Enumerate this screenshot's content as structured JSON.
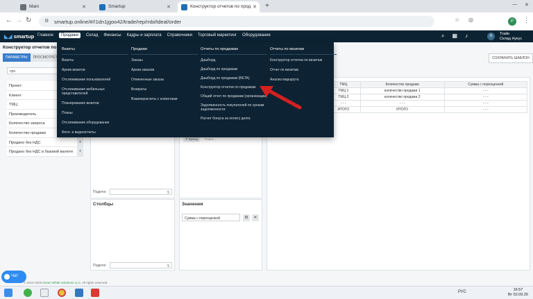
{
  "browser": {
    "tabs": [
      {
        "label": "Main",
        "color": "#6a6f77"
      },
      {
        "label": "Smartup",
        "color": "#1e6fb5"
      },
      {
        "label": "Конструктор отчетов по прод",
        "color": "#1e6fb5"
      }
    ],
    "url": "smartup.online/#/!1dn1jgoo42/trade/rep/mbi/tdeal/order"
  },
  "header": {
    "logo": "smartup",
    "menu": [
      "Главное",
      "Продажи",
      "Склад",
      "Финансы",
      "Кадры и зарплата",
      "Справочники",
      "Торговый маркетинг",
      "Оборудование"
    ],
    "active_menu": "Продажи",
    "avatar_letter": "A",
    "user_line1": "Trade",
    "user_line2": "Склад Нукус"
  },
  "page": {
    "title": "Конструктор отчетов по п",
    "tabs": [
      "ПАРАМЕТРЫ",
      "ПРОСМОТРЕТЬ"
    ],
    "save_template": "СОХРАНИТЬ ШАБЛОН",
    "filter_value": "про",
    "fields": [
      "Проект",
      "Клиент",
      "ТМЦ",
      "Производитель",
      "Количество запроса",
      "Количество продажи",
      "Продано без НДС",
      "Продано без НДС в базовой валюте"
    ],
    "columns_title": "Столбцы",
    "values_title": "Значения",
    "per_page_label": "Подитог",
    "per_page_value": "5",
    "chip_brand": "Бренд",
    "chip_search": "Поиск...",
    "value_field": "Сумма с переоценкой"
  },
  "table": {
    "headers": [
      "ТМЦ",
      "Количество продажи",
      "Сумма с переоценкой"
    ],
    "rows": [
      [
        "ТМЦ 1",
        "количество продажи 1",
        "- - -"
      ],
      [
        "ТМЦ 2",
        "количество продажи 2",
        "- - -"
      ],
      [
        "- - -",
        "- - -",
        "- - -"
      ],
      [
        "ИТОГО",
        "ИТОГО",
        "- - -"
      ]
    ]
  },
  "dropdown": {
    "col1": {
      "head": "Визиты",
      "items": [
        "Визиты",
        "Архив визитов",
        "Отслеживание пользователей",
        "Отслеживание мобильных представителей",
        "Планирование визитов",
        "Планы",
        "Отслеживание оборудования",
        "Фото- и видеоотчеты"
      ]
    },
    "col2": {
      "head": "Продажи",
      "items": [
        "Заказы",
        "Архив заказов",
        "Отмененные заказы",
        "Возвраты",
        "Взаиморасчеты с клиентами"
      ]
    },
    "col3": {
      "head": "Отчеты по продажам",
      "items": [
        "Дашборд",
        "Дашборд по продажам",
        "Дашборд по продажам (BETA)",
        "Конструктор отчетов по продажам",
        "Общий отчет по продажам (организации)",
        "Задолженность покупателей по срокам задолженности",
        "Расчет бонуса за оплату долга"
      ]
    },
    "col4": {
      "head": "Отчеты по визитам",
      "items": [
        "Конструктор отчетов по визитам",
        "Отчет по визитам",
        "Анализ маршрута"
      ]
    }
  },
  "footer": {
    "copyright": "© 2012-2025",
    "company": "Green White Solutions LLC.",
    "rights": "All rights reserved."
  },
  "chat_label": "Чат",
  "taskbar": {
    "lang": "РУС",
    "time": "16:57",
    "date": "Вт 02.09.25"
  }
}
